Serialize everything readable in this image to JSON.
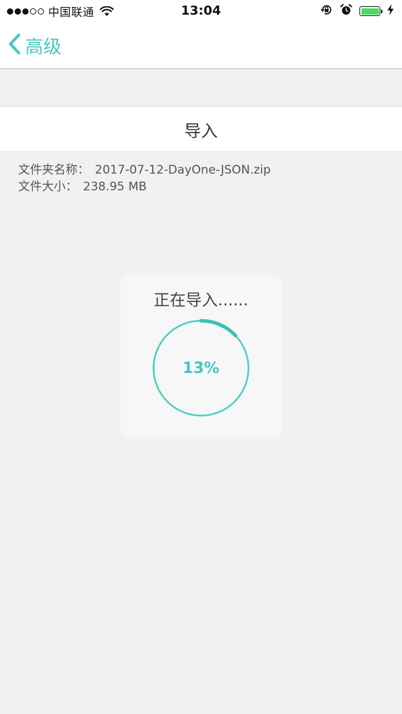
{
  "status_bar": {
    "carrier": "中国联通",
    "time": "13:04",
    "signal_strength": 3,
    "battery_level": 1.0
  },
  "nav": {
    "back_label": "高级"
  },
  "import": {
    "title": "导入",
    "folder_name_label": "文件夹名称：",
    "folder_name_value": "2017-07-12-DayOne-JSON.zip",
    "file_size_label": "文件大小：",
    "file_size_value": "238.95 MB"
  },
  "progress": {
    "title": "正在导入......",
    "percent_text": "13%",
    "percent": 13
  },
  "colors": {
    "accent": "#45c8bf",
    "battery": "#4cd964",
    "background": "#f2f1f0"
  },
  "icons": {
    "back": "chevron-left-icon",
    "wifi": "wifi-icon",
    "orientation_lock": "orientation-lock-icon",
    "alarm": "alarm-icon",
    "battery": "battery-icon",
    "charging": "lightning-icon"
  }
}
